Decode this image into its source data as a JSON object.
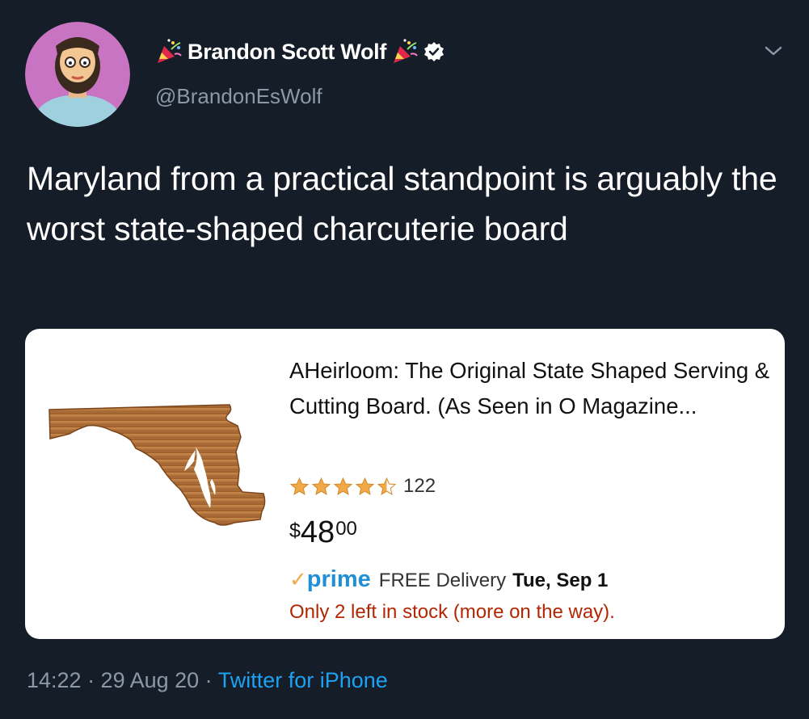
{
  "tweet": {
    "display_name": "Brandon Scott Wolf",
    "handle": "@BrandonEsWolf",
    "text": "Maryland from a practical standpoint is arguably the worst state-shaped charcuterie board",
    "timestamp": "14:22 · 29 Aug 20 ·",
    "source": "Twitter for iPhone"
  },
  "card": {
    "title": "AHeirloom: The Original State Shaped Serving & Cutting Board. (As Seen in O Magazine...",
    "rating": 4.5,
    "review_count": "122",
    "price_symbol": "$",
    "price_whole": "48",
    "price_fraction": "00",
    "prime_check": "✓",
    "prime_label": "prime",
    "delivery_text": "FREE Delivery",
    "delivery_date": "Tue, Sep 1",
    "stock_text": "Only 2 left in stock (more on the way)."
  },
  "colors": {
    "background": "#151d29",
    "muted": "#8b98a5",
    "link": "#1da1f2",
    "prime": "#1f8fd6",
    "star": "#f3a847",
    "stock": "#b12704"
  },
  "icons": {
    "avatar": "bearded-man-avatar",
    "party": "party-popper-icon",
    "verified": "verified-badge-icon",
    "chevron": "chevron-down-icon",
    "star": "star-icon"
  }
}
